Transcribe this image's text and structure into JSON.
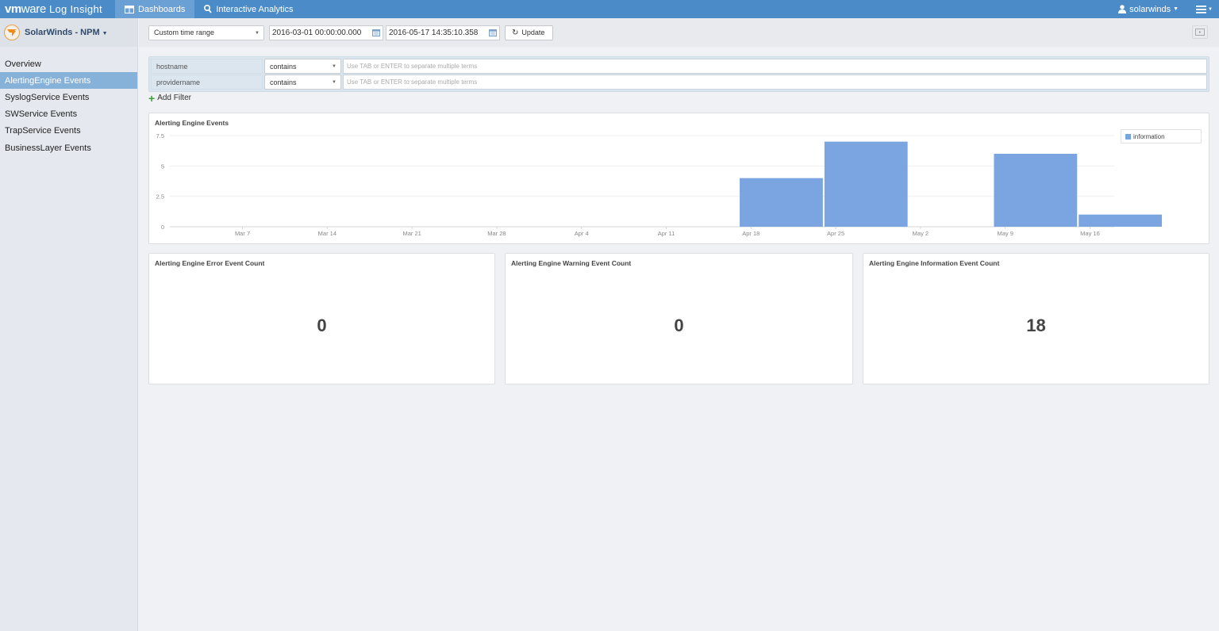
{
  "app": {
    "brand_vm": "vm",
    "brand_ware": "ware",
    "brand_product": "Log Insight"
  },
  "nav": {
    "tabs": [
      {
        "label": "Dashboards",
        "icon": "dashboard-icon",
        "active": true
      },
      {
        "label": "Interactive Analytics",
        "icon": "search-icon",
        "active": false
      }
    ],
    "user": "solarwinds"
  },
  "sidebar": {
    "dashboard_title": "SolarWinds - NPM",
    "items": [
      {
        "label": "Overview",
        "active": false
      },
      {
        "label": "AlertingEngine Events",
        "active": true
      },
      {
        "label": "SyslogService Events",
        "active": false
      },
      {
        "label": "SWService Events",
        "active": false
      },
      {
        "label": "TrapService Events",
        "active": false
      },
      {
        "label": "BusinessLayer Events",
        "active": false
      }
    ]
  },
  "toolbar": {
    "time_range": "Custom time range",
    "start": "2016-03-01 00:00:00.000",
    "end": "2016-05-17 14:35:10.358",
    "update_label": "Update"
  },
  "filters": {
    "rows": [
      {
        "field": "hostname",
        "operator": "contains",
        "placeholder": "Use TAB or ENTER to separate multiple terms"
      },
      {
        "field": "providername",
        "operator": "contains",
        "placeholder": "Use TAB or ENTER to separate multiple terms"
      }
    ],
    "add_label": "Add Filter"
  },
  "chart_data": {
    "type": "bar",
    "title": "Alerting Engine Events",
    "xlabel": "",
    "ylabel": "",
    "ylim": [
      0,
      7.5
    ],
    "yticks": [
      "0",
      "2.5",
      "5",
      "7.5"
    ],
    "ytick_values": [
      0,
      2.5,
      5,
      7.5
    ],
    "xticks": [
      "Mar 7",
      "Mar 14",
      "Mar 21",
      "Mar 28",
      "Apr 4",
      "Apr 11",
      "Apr 18",
      "Apr 25",
      "May 2",
      "May 9",
      "May 16"
    ],
    "xrange_days": [
      "2016-03-01",
      "2016-05-18"
    ],
    "grid": true,
    "legend_position": "top-right",
    "series": [
      {
        "name": "information",
        "color": "#7aa5e0",
        "bins": [
          {
            "week_start": "2016-04-17",
            "value": 4
          },
          {
            "week_start": "2016-04-24",
            "value": 7
          },
          {
            "week_start": "2016-05-01",
            "value": 0
          },
          {
            "week_start": "2016-05-08",
            "value": 6
          },
          {
            "week_start": "2016-05-15",
            "value": 1
          }
        ]
      }
    ]
  },
  "counts": [
    {
      "title": "Alerting Engine Error Event Count",
      "value": "0"
    },
    {
      "title": "Alerting Engine Warning Event Count",
      "value": "0"
    },
    {
      "title": "Alerting Engine Information Event Count",
      "value": "18"
    }
  ]
}
